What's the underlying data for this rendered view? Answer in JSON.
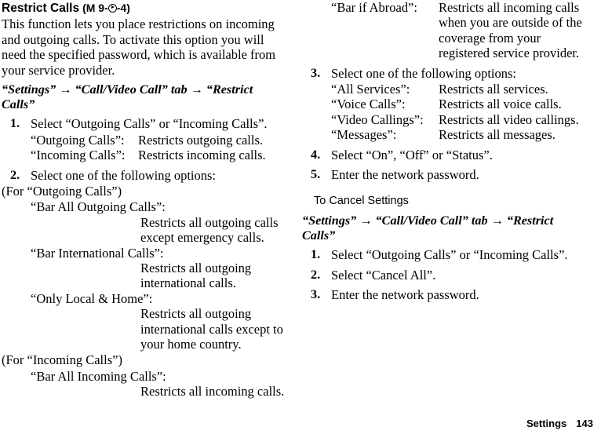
{
  "title": {
    "name": "Restrict Calls",
    "key_ref_prefix": "(M 9-",
    "key_ref_suffix": "-4)",
    "key_icon": "navigation-key-right-icon"
  },
  "intro": "This function lets you place restrictions on incoming and outgoing calls. To activate this option you will need the specified password, which is available from your service provider.",
  "breadcrumb_main": {
    "part1": "“Settings”",
    "arrow1": "→",
    "part2": "“Call/Video Call” tab",
    "arrow2": "→",
    "part3": "“Restrict Calls”"
  },
  "steps": {
    "s1_num": "1.",
    "s1_text": "Select “Outgoing Calls” or “Incoming Calls”.",
    "s2_num": "2.",
    "s2_text": "Select one of the following options:",
    "s3_num": "3.",
    "s3_text": "Select one of the following options:",
    "s4_num": "4.",
    "s4_text": "Select “On”, “Off” or “Status”.",
    "s5_num": "5.",
    "s5_text": "Enter the network password."
  },
  "call_direction_defs": [
    {
      "term": "“Outgoing Calls”:",
      "desc": "Restricts outgoing calls."
    },
    {
      "term": "“Incoming Calls”:",
      "desc": "Restricts incoming calls."
    }
  ],
  "for_outgoing_label": "(For “Outgoing Calls”)",
  "outgoing_options": [
    {
      "term": "“Bar All Outgoing Calls”:",
      "desc": "Restricts all outgoing calls except emergency calls."
    },
    {
      "term": "“Bar International Calls”:",
      "desc": "Restricts all outgoing international calls."
    },
    {
      "term": "“Only Local & Home”:",
      "desc": "Restricts all outgoing international calls except to your home country."
    }
  ],
  "for_incoming_label": "(For “Incoming Calls”)",
  "incoming_options": [
    {
      "term": "“Bar All Incoming Calls”:",
      "desc": "Restricts all incoming calls."
    },
    {
      "term": "“Bar if Abroad”:",
      "desc": "Restricts all incoming calls when you are outside of the coverage from your registered service provider."
    }
  ],
  "service_options": [
    {
      "term": "“All Services”:",
      "desc": "Restricts all services."
    },
    {
      "term": "“Voice Calls”:",
      "desc": "Restricts all voice calls."
    },
    {
      "term": "“Video Callings”:",
      "desc": "Restricts all video callings."
    },
    {
      "term": "“Messages”:",
      "desc": "Restricts all messages."
    }
  ],
  "cancel_section": {
    "heading": "To Cancel Settings",
    "breadcrumb": {
      "part1": "“Settings”",
      "arrow1": "→",
      "part2": "“Call/Video Call” tab",
      "arrow2": "→",
      "part3": "“Restrict Calls”"
    },
    "steps": [
      {
        "num": "1.",
        "text": "Select “Outgoing Calls” or “Incoming Calls”."
      },
      {
        "num": "2.",
        "text": "Select “Cancel All”."
      },
      {
        "num": "3.",
        "text": "Enter the network password."
      }
    ]
  },
  "footer": {
    "section": "Settings",
    "page_number": "143"
  }
}
